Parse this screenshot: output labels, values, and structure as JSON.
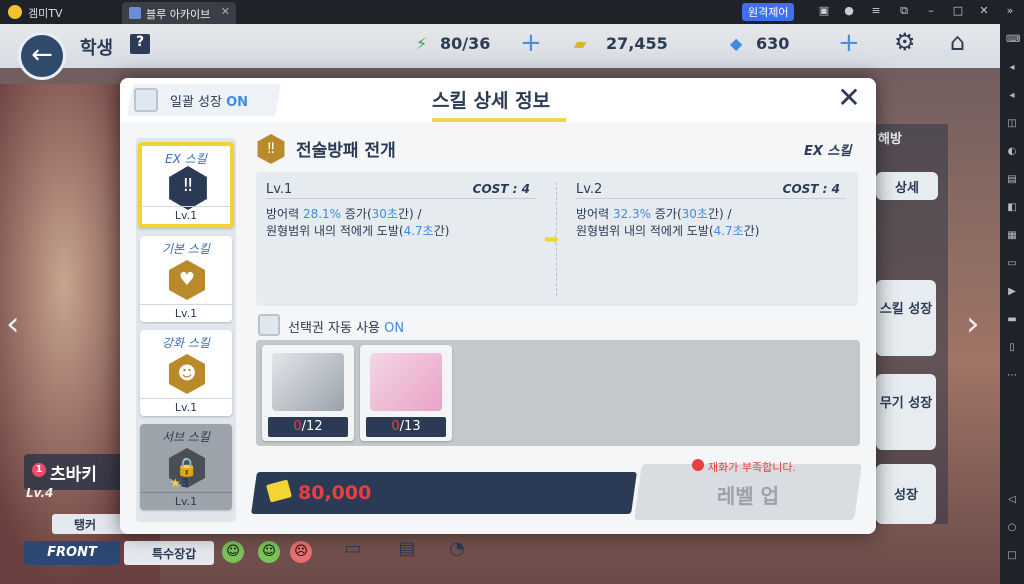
{
  "emulator": {
    "brand": "겜미TV",
    "tab_title": "블루 아카이브",
    "remote_label": "원격제어"
  },
  "header": {
    "page_title": "학생",
    "help_label": "?",
    "stamina": "80/36",
    "credits": "27,455",
    "gems": "630"
  },
  "student": {
    "rank": "1",
    "name": "츠바키",
    "level": "Lv.4",
    "role": "탱커",
    "position": "FRONT",
    "armor": "특수장갑"
  },
  "right_menu": {
    "detail": "상세",
    "skill_up": "스킬 성장",
    "weapon_up": "무기 성장",
    "growth": "성장",
    "unlock": "해방"
  },
  "modal": {
    "bulk_growth_label": "일괄 성장",
    "bulk_growth_state": "ON",
    "title": "스킬 상세 정보",
    "skill_tabs": [
      {
        "label": "EX 스킬",
        "level": "Lv.1"
      },
      {
        "label": "기본 스킬",
        "level": "Lv.1"
      },
      {
        "label": "강화 스킬",
        "level": "Lv.1"
      },
      {
        "label": "서브 스킬",
        "level": "Lv.1",
        "stars": "3"
      }
    ],
    "skill_name": "전술방패 전개",
    "skill_type": "EX 스킬",
    "current": {
      "level": "Lv.1",
      "cost": "COST : 4",
      "pre": "방어력 ",
      "pct": "28.1%",
      "mid": " 증가(",
      "dur": "30초",
      "post": "간) /",
      "line2_pre": "원형범위 내의 적에게 도발(",
      "taunt": "4.7초",
      "line2_post": "간)"
    },
    "next": {
      "level": "Lv.2",
      "cost": "COST : 4",
      "pre": "방어력 ",
      "pct": "32.3%",
      "mid": " 증가(",
      "dur": "30초",
      "post": "간) /",
      "line2_pre": "원형범위 내의 적에게 도발(",
      "taunt": "4.7초",
      "line2_post": "간)"
    },
    "auto_ticket_label": "선택권 자동 사용",
    "auto_ticket_state": "ON",
    "items": [
      {
        "owned": "0",
        "required": "/12"
      },
      {
        "owned": "0",
        "required": "/13"
      }
    ],
    "cost_value": "80,000",
    "warning": "재화가 부족합니다.",
    "level_up_label": "레벨 업"
  }
}
